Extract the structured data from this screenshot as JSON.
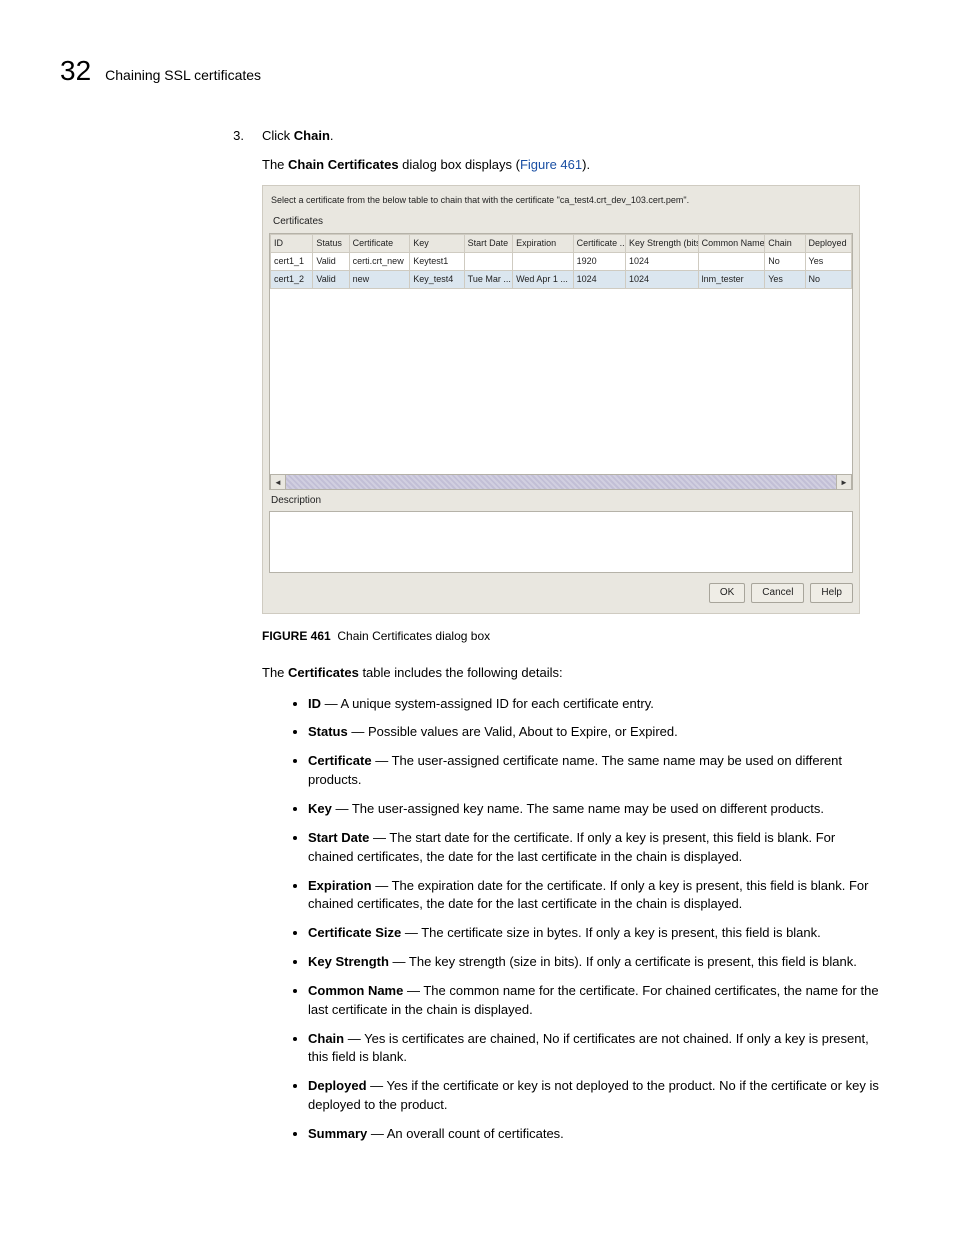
{
  "header": {
    "chapter_number": "32",
    "section_title": "Chaining SSL certificates"
  },
  "step": {
    "number": "3.",
    "line1_pre": "Click ",
    "line1_bold": "Chain",
    "line1_post": ".",
    "line2_pre": "The ",
    "line2_bold": "Chain Certificates",
    "line2_mid": " dialog box displays (",
    "line2_link": "Figure 461",
    "line2_post": ")."
  },
  "dialog": {
    "instruction": "Select a certificate from the below table to chain that with the certificate \"ca_test4.crt_dev_103.cert.pem\".",
    "panel_title": "Certificates",
    "columns": [
      "ID",
      "Status",
      "Certificate",
      "Key",
      "Start Date",
      "Expiration",
      "Certificate ...",
      "Key Strength (bits)",
      "Common Name",
      "Chain",
      "Deployed"
    ],
    "rows": [
      {
        "id": "cert1_1",
        "status": "Valid",
        "cert": "certi.crt_new",
        "key": "Keytest1",
        "start": "",
        "exp": "",
        "size": "1920",
        "keystr": "1024",
        "cn": "",
        "chain": "No",
        "deployed": "Yes"
      },
      {
        "id": "cert1_2",
        "status": "Valid",
        "cert": "new",
        "key": "Key_test4",
        "start": "Tue Mar ...",
        "exp": "Wed Apr 1 ...",
        "size": "1024",
        "keystr": "1024",
        "cn": "lnm_tester",
        "chain": "Yes",
        "deployed": "No"
      }
    ],
    "desc_label": "Description",
    "buttons": {
      "ok": "OK",
      "cancel": "Cancel",
      "help": "Help"
    },
    "scroll_left": "◄",
    "scroll_right": "►"
  },
  "figure": {
    "label": "FIGURE 461",
    "caption": "Chain Certificates dialog box"
  },
  "intro_pre": "The ",
  "intro_bold": "Certificates",
  "intro_post": " table includes the following details:",
  "details": [
    {
      "term": "ID",
      "desc": " — A unique system-assigned ID for each certificate entry."
    },
    {
      "term": "Status",
      "desc": " — Possible values are Valid, About to Expire, or Expired."
    },
    {
      "term": "Certificate",
      "desc": " — The user-assigned certificate name. The same name may be used on different products."
    },
    {
      "term": "Key",
      "desc": " — The user-assigned key name. The same name may be used on different products."
    },
    {
      "term": "Start Date",
      "desc": " — The start date for the certificate. If only a key is present, this field is blank. For chained certificates, the date for the last certificate in the chain is displayed."
    },
    {
      "term": "Expiration",
      "desc": " — The expiration date for the certificate. If only a key is present, this field is blank. For chained certificates, the date for the last certificate in the chain is displayed."
    },
    {
      "term": "Certificate Size",
      "desc": " — The certificate size in bytes. If only a key is present, this field is blank."
    },
    {
      "term": "Key Strength",
      "desc": " — The key strength (size in bits). If only a certificate is present, this field is blank."
    },
    {
      "term": "Common Name",
      "desc": " — The common name for the certificate. For chained certificates, the name for the last certificate in the chain is displayed."
    },
    {
      "term": "Chain",
      "desc": " — Yes is certificates are chained, No if certificates are not chained. If only a key is present, this field is blank."
    },
    {
      "term": "Deployed",
      "desc": " — Yes if the certificate or key is not deployed to the product. No if the certificate or key is deployed to the product."
    },
    {
      "term": "Summary",
      "desc": " — An overall count of certificates."
    }
  ]
}
